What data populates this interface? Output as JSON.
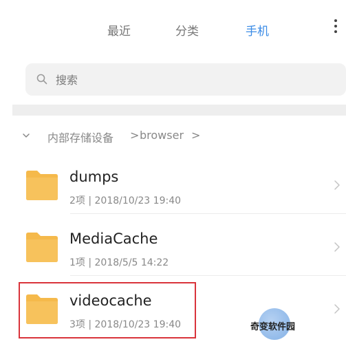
{
  "tabs": [
    {
      "label": "最近",
      "active": false
    },
    {
      "label": "分类",
      "active": false
    },
    {
      "label": "手机",
      "active": true
    }
  ],
  "search": {
    "placeholder": "搜索"
  },
  "breadcrumb": {
    "root": "内部存储设备",
    "separator": ">",
    "child": "browser"
  },
  "folders": [
    {
      "name": "dumps",
      "meta": "2项 | 2018/10/23 19:40"
    },
    {
      "name": "MediaCache",
      "meta": "1项 | 2018/5/5 14:22"
    },
    {
      "name": "videocache",
      "meta": "3项 | 2018/10/23 19:40"
    }
  ],
  "watermark": {
    "text": "奇变软件园"
  },
  "colors": {
    "accent": "#3a8be6",
    "folder": "#f5b94b",
    "highlight": "#d9333a"
  }
}
